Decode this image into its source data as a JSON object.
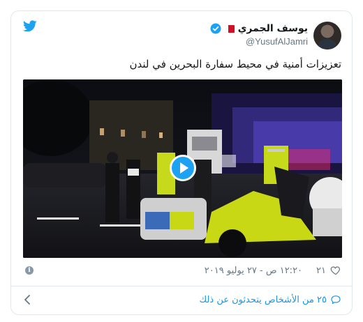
{
  "author": {
    "display_name": "يوسف الجمري",
    "handle": "@YusufAlJamri",
    "verified": true,
    "flag": "bahrain-flag"
  },
  "tweet": {
    "text": "تعزيزات أمنية في محيط سفارة البحرين في لندن"
  },
  "media": {
    "type": "video",
    "play_icon": "play-icon"
  },
  "meta": {
    "like_count": "٢١",
    "timestamp": "١٢:٢٠ ص - ٢٧ يوليو ٢٠١٩"
  },
  "conversation": {
    "label": "٢٥ من الأشخاص يتحدثون عن ذلك"
  },
  "colors": {
    "twitter_blue": "#1da1f2",
    "link_blue": "#1b95e0",
    "muted_gray": "#657786",
    "border": "#e1e8ed"
  },
  "icons": {
    "logo": "twitter-bird-icon",
    "verified": "verified-badge-icon",
    "like": "heart-icon",
    "info": "info-icon",
    "reply": "chat-bubble-icon",
    "back": "chevron-left-icon"
  }
}
